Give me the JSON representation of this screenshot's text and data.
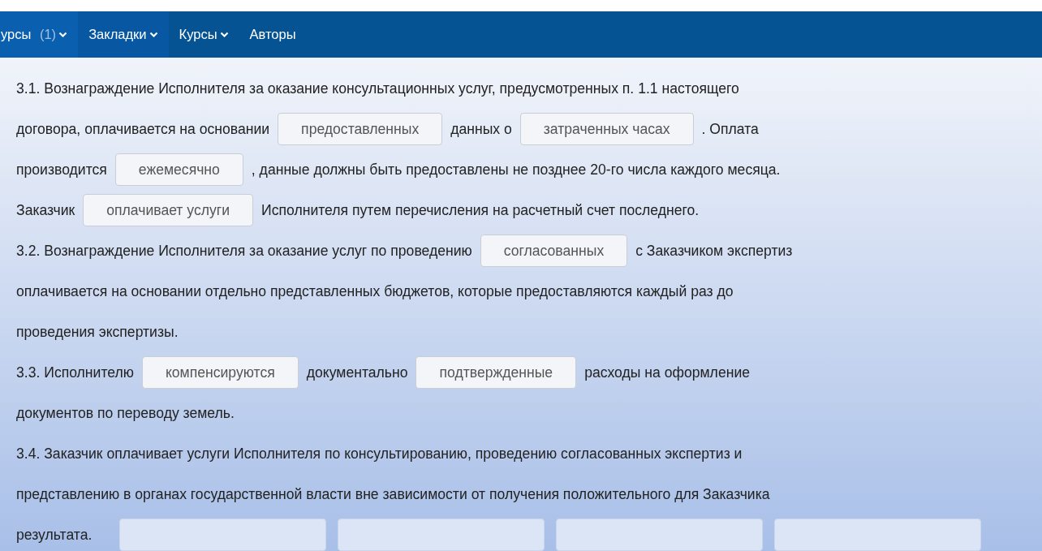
{
  "nav": [
    {
      "label": "урсы",
      "count": "(1)",
      "dropdown": true,
      "selected": true,
      "hover": false
    },
    {
      "label": "Закладки",
      "dropdown": true,
      "selected": false,
      "hover": true
    },
    {
      "label": "Курсы",
      "dropdown": true,
      "selected": false,
      "hover": false
    },
    {
      "label": "Авторы",
      "dropdown": false,
      "selected": false,
      "hover": false
    }
  ],
  "lines": [
    [
      {
        "kind": "text",
        "text": "3.1. Вознаграждение Исполнителя за оказание консультационных услуг, предусмотренных п. 1.1 настоящего"
      }
    ],
    [
      {
        "kind": "text",
        "text": "договора, оплачивается на основании"
      },
      {
        "kind": "answer",
        "text": "предоставленных"
      },
      {
        "kind": "text",
        "text": "данных о"
      },
      {
        "kind": "answer",
        "text": "затраченных часах"
      },
      {
        "kind": "text",
        "text": ". Оплата"
      }
    ],
    [
      {
        "kind": "text",
        "text": "производится"
      },
      {
        "kind": "answer",
        "text": "ежемесячно"
      },
      {
        "kind": "text",
        "text": ", данные должны быть предоставлены не позднее 20-го числа каждого месяца."
      }
    ],
    [
      {
        "kind": "text",
        "text": "Заказчик"
      },
      {
        "kind": "answer",
        "text": "оплачивает услуги"
      },
      {
        "kind": "text",
        "text": "Исполнителя путем перечисления на расчетный счет последнего."
      }
    ],
    [
      {
        "kind": "text",
        "text": "3.2. Вознаграждение Исполнителя за оказание услуг по проведению"
      },
      {
        "kind": "answer",
        "text": "согласованных"
      },
      {
        "kind": "text",
        "text": "с Заказчиком экспертиз"
      }
    ],
    [
      {
        "kind": "text",
        "text": "оплачивается на основании отдельно представленных бюджетов, которые предоставляются каждый раз до"
      }
    ],
    [
      {
        "kind": "text",
        "text": "проведения экспертизы."
      }
    ],
    [
      {
        "kind": "text",
        "text": "3.3. Исполнителю"
      },
      {
        "kind": "answer",
        "text": "компенсируются"
      },
      {
        "kind": "text",
        "text": "документально"
      },
      {
        "kind": "answer",
        "text": "подтвержденные"
      },
      {
        "kind": "text",
        "text": "расходы на оформление"
      }
    ],
    [
      {
        "kind": "text",
        "text": "документов по переводу земель."
      }
    ],
    [
      {
        "kind": "text",
        "text": "3.4. Заказчик оплачивает услуги Исполнителя по консультированию, проведению согласованных экспертиз и"
      }
    ],
    [
      {
        "kind": "text",
        "text": "представлению в органах государственной власти вне зависимости от получения положительного для Заказчика"
      }
    ],
    [
      {
        "kind": "text",
        "text": "результата."
      },
      {
        "kind": "slot"
      },
      {
        "kind": "slot"
      },
      {
        "kind": "slot"
      },
      {
        "kind": "slot"
      }
    ]
  ]
}
